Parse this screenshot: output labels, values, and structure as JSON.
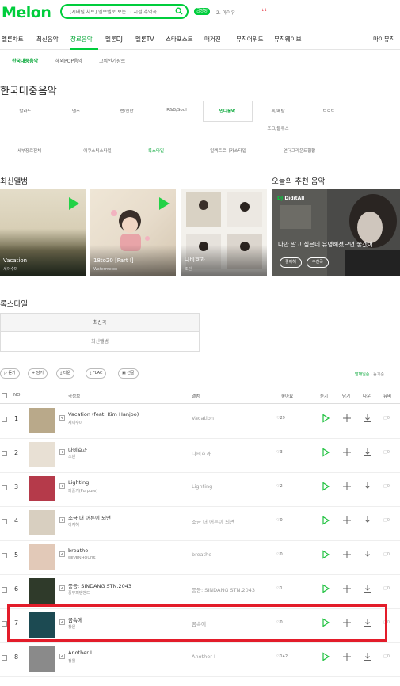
{
  "header": {
    "logo": "Melon",
    "search_placeholder": "[시태릴 차트] 멤브렐로 보는 그 시절 추억곡",
    "badge": "금방정",
    "user_text": "2. 아이유",
    "extra": "↓1"
  },
  "nav": {
    "items": [
      "멜론차트",
      "최신음악",
      "장르음악",
      "멜론DJ",
      "멜론TV",
      "스타포스트",
      "매거진",
      "뮤직어워드",
      "뮤직웨이브"
    ],
    "right": "마이뮤직"
  },
  "subnav": [
    "한국대중음악",
    "해외POP음악",
    "그외인기장르"
  ],
  "page_title": "한국대중음악",
  "genres": {
    "row1": [
      "발라드",
      "댄스",
      "랩/힙합",
      "R&B/Soul",
      "인디음악",
      "록/메탈",
      "트로트"
    ],
    "row2": [
      "포크/블루스"
    ]
  },
  "sub_genres": [
    "세부장르전체",
    "어쿠스틱스타일",
    "록스타일",
    "일렉트로니카스타일",
    "언더그라운드힙합"
  ],
  "latest_albums": {
    "title": "최신앨범",
    "cards": [
      {
        "title": "Vacation",
        "artist": "세이수미"
      },
      {
        "title": "18to20 [Part I]",
        "artist": "Watermelon"
      },
      {
        "title": "나비효과",
        "artist": "조빈"
      }
    ]
  },
  "recommend": {
    "title": "오늘의 추천 음악",
    "dj_prefix": "DJ",
    "dj_name": "DiditAll",
    "text": "나만 알고 싶은데 유명해졌으면 좋겠어",
    "btn1": "좋아해",
    "btn2": "추천곡"
  },
  "rock_style": {
    "title": "록스타일",
    "tab_active": "최신곡",
    "tab_other": "최신앨범"
  },
  "toolbar": {
    "play": "듣기",
    "add": "담기",
    "download": "다운",
    "flac": "FLAC",
    "gift": "선물",
    "sort_active": "발매일순",
    "sort_other": "· 듣기순"
  },
  "table_header": {
    "no": "NO",
    "song": "곡정보",
    "album": "앨범",
    "like": "좋아요",
    "listen": "듣기",
    "add": "담기",
    "download": "다운",
    "mv": "뮤비"
  },
  "songs": [
    {
      "no": "1",
      "title": "Vacation (feat. Kim Hanjoo)",
      "artist": "세이수미",
      "album": "Vacation",
      "likes": "29",
      "thumb_color": "#b9a98a"
    },
    {
      "no": "2",
      "title": "나비효과",
      "artist": "조빈",
      "album": "나비효과",
      "likes": "3",
      "thumb_color": "#e8e0d4"
    },
    {
      "no": "3",
      "title": "Lighting",
      "artist": "퍼플키(Purpure)",
      "album": "Lighting",
      "likes": "2",
      "thumb_color": "#b53a4a"
    },
    {
      "no": "4",
      "title": "조금 더 어른이 되면",
      "artist": "이지혜",
      "album": "조금 더 어른이 되면",
      "likes": "0",
      "thumb_color": "#d8cfc0"
    },
    {
      "no": "5",
      "title": "breathe",
      "artist": "SEVENHOURS",
      "album": "breathe",
      "likes": "0",
      "thumb_color": "#e2c9b8"
    },
    {
      "no": "6",
      "title": "풍등: SINDANG STN.2043",
      "artist": "풍부퍼텐밴드",
      "album": "풍등: SINDANG STN.2043",
      "likes": "1",
      "thumb_color": "#2f3a2a"
    },
    {
      "no": "7",
      "title": "꿈속에",
      "artist": "창원",
      "album": "꿈속에",
      "likes": "0",
      "thumb_color": "#1c4a52"
    },
    {
      "no": "8",
      "title": "Another I",
      "artist": "정월",
      "album": "Another I",
      "likes": "142",
      "thumb_color": "#8a8a8a"
    }
  ],
  "colors": {
    "brand": "#00cd3c",
    "highlight": "#e31c2a"
  }
}
